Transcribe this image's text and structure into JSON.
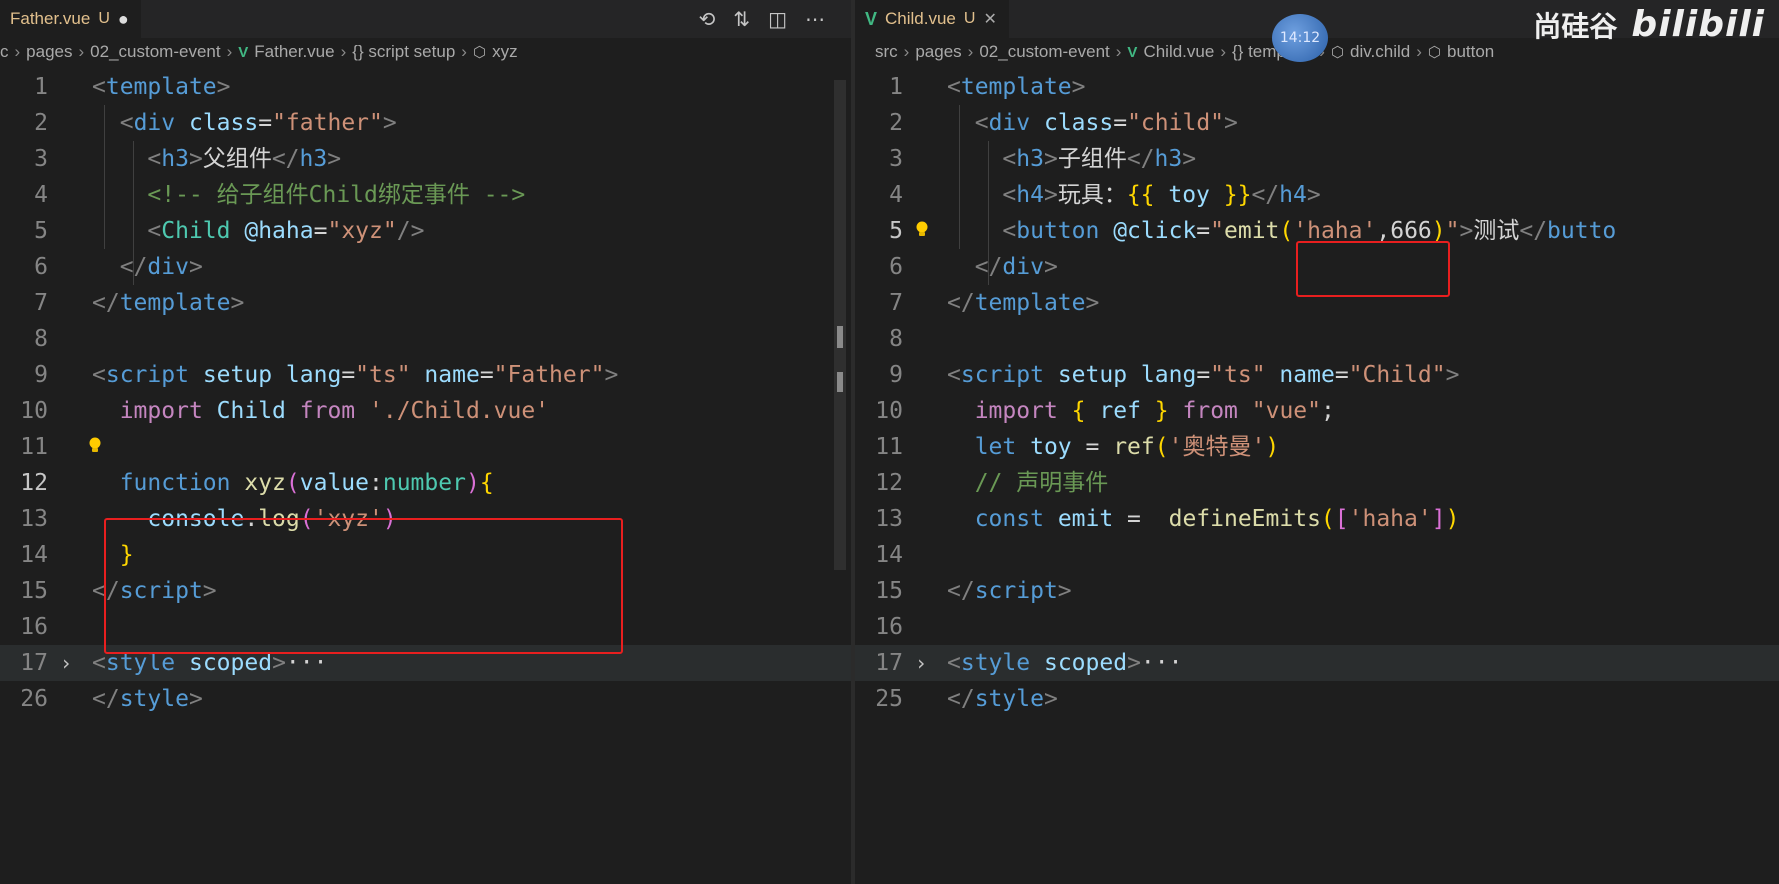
{
  "left": {
    "tab": {
      "filename": "Father.vue",
      "status": "U",
      "dirty": "●"
    },
    "breadcrumb": [
      "c",
      "pages",
      "02_custom-event",
      "Father.vue",
      "{} script setup",
      "xyz"
    ],
    "lines": [
      {
        "n": "1",
        "tokens": [
          [
            "<",
            "brk"
          ],
          [
            "template",
            "tag"
          ],
          [
            ">",
            "brk"
          ]
        ]
      },
      {
        "n": "2",
        "tokens": [
          [
            "  ",
            ""
          ],
          [
            "<",
            "brk"
          ],
          [
            "div",
            "tag"
          ],
          [
            " ",
            ""
          ],
          [
            "class",
            "attr"
          ],
          [
            "=",
            "txt"
          ],
          [
            "\"father\"",
            "str"
          ],
          [
            ">",
            "brk"
          ]
        ]
      },
      {
        "n": "3",
        "tokens": [
          [
            "    ",
            ""
          ],
          [
            "<",
            "brk"
          ],
          [
            "h3",
            "tag"
          ],
          [
            ">",
            "brk"
          ],
          [
            "父组件",
            "chn"
          ],
          [
            "</",
            "brk"
          ],
          [
            "h3",
            "tag"
          ],
          [
            ">",
            "brk"
          ]
        ]
      },
      {
        "n": "4",
        "tokens": [
          [
            "    ",
            ""
          ],
          [
            "<!-- 给子组件Child绑定事件 -->",
            "cmt"
          ]
        ]
      },
      {
        "n": "5",
        "tokens": [
          [
            "    ",
            ""
          ],
          [
            "<",
            "brk"
          ],
          [
            "Child",
            "type"
          ],
          [
            " ",
            ""
          ],
          [
            "@haha",
            "attr"
          ],
          [
            "=",
            "txt"
          ],
          [
            "\"xyz\"",
            "str"
          ],
          [
            "/>",
            "brk"
          ]
        ]
      },
      {
        "n": "6",
        "tokens": [
          [
            "  ",
            ""
          ],
          [
            "</",
            "brk"
          ],
          [
            "div",
            "tag"
          ],
          [
            ">",
            "brk"
          ]
        ]
      },
      {
        "n": "7",
        "tokens": [
          [
            "</",
            "brk"
          ],
          [
            "template",
            "tag"
          ],
          [
            ">",
            "brk"
          ]
        ]
      },
      {
        "n": "8",
        "tokens": []
      },
      {
        "n": "9",
        "tokens": [
          [
            "<",
            "brk"
          ],
          [
            "script",
            "tag"
          ],
          [
            " ",
            ""
          ],
          [
            "setup",
            "attr"
          ],
          [
            " ",
            ""
          ],
          [
            "lang",
            "attr"
          ],
          [
            "=",
            "txt"
          ],
          [
            "\"ts\"",
            "str"
          ],
          [
            " ",
            ""
          ],
          [
            "name",
            "attr"
          ],
          [
            "=",
            "txt"
          ],
          [
            "\"Father\"",
            "str"
          ],
          [
            ">",
            "brk"
          ]
        ]
      },
      {
        "n": "10",
        "tokens": [
          [
            "  ",
            ""
          ],
          [
            "import",
            "kw2"
          ],
          [
            " ",
            ""
          ],
          [
            "Child",
            "attr"
          ],
          [
            " ",
            ""
          ],
          [
            "from",
            "kw2"
          ],
          [
            " ",
            ""
          ],
          [
            "'./Child.vue'",
            "str"
          ]
        ]
      },
      {
        "n": "11",
        "tokens": []
      },
      {
        "n": "12",
        "tokens": [
          [
            "  ",
            ""
          ],
          [
            "function",
            "kw"
          ],
          [
            " ",
            ""
          ],
          [
            "xyz",
            "fn"
          ],
          [
            "(",
            "br2"
          ],
          [
            "value",
            "attr"
          ],
          [
            ":",
            "txt"
          ],
          [
            "number",
            "type"
          ],
          [
            ")",
            "br2"
          ],
          [
            "{",
            "br1"
          ]
        ]
      },
      {
        "n": "13",
        "tokens": [
          [
            "    ",
            ""
          ],
          [
            "console",
            "attr"
          ],
          [
            ".",
            "txt"
          ],
          [
            "log",
            "fn"
          ],
          [
            "(",
            "br2"
          ],
          [
            "'xyz'",
            "str"
          ],
          [
            ")",
            "br2"
          ]
        ]
      },
      {
        "n": "14",
        "tokens": [
          [
            "  ",
            ""
          ],
          [
            "}",
            "br1"
          ]
        ]
      },
      {
        "n": "15",
        "tokens": [
          [
            "</",
            "brk"
          ],
          [
            "script",
            "tag"
          ],
          [
            ">",
            "brk"
          ]
        ]
      },
      {
        "n": "16",
        "tokens": []
      },
      {
        "n": "17",
        "tokens": [
          [
            "<",
            "brk"
          ],
          [
            "style",
            "tag"
          ],
          [
            " ",
            ""
          ],
          [
            "scoped",
            "attr"
          ],
          [
            ">",
            "brk"
          ],
          [
            "···",
            "txt"
          ]
        ]
      },
      {
        "n": "26",
        "tokens": [
          [
            "</",
            "brk"
          ],
          [
            "style",
            "tag"
          ],
          [
            ">",
            "brk"
          ]
        ]
      }
    ]
  },
  "right": {
    "tab": {
      "filename": "Child.vue",
      "status": "U",
      "close": "✕"
    },
    "breadcrumb": [
      "src",
      "pages",
      "02_custom-event",
      "Child.vue",
      "{} template",
      "div.child",
      "button"
    ],
    "lines": [
      {
        "n": "1",
        "tokens": [
          [
            "<",
            "brk"
          ],
          [
            "template",
            "tag"
          ],
          [
            ">",
            "brk"
          ]
        ]
      },
      {
        "n": "2",
        "tokens": [
          [
            "  ",
            ""
          ],
          [
            "<",
            "brk"
          ],
          [
            "div",
            "tag"
          ],
          [
            " ",
            ""
          ],
          [
            "class",
            "attr"
          ],
          [
            "=",
            "txt"
          ],
          [
            "\"child\"",
            "str"
          ],
          [
            ">",
            "brk"
          ]
        ]
      },
      {
        "n": "3",
        "tokens": [
          [
            "    ",
            ""
          ],
          [
            "<",
            "brk"
          ],
          [
            "h3",
            "tag"
          ],
          [
            ">",
            "brk"
          ],
          [
            "子组件",
            "chn"
          ],
          [
            "</",
            "brk"
          ],
          [
            "h3",
            "tag"
          ],
          [
            ">",
            "brk"
          ]
        ]
      },
      {
        "n": "4",
        "tokens": [
          [
            "    ",
            ""
          ],
          [
            "<",
            "brk"
          ],
          [
            "h4",
            "tag"
          ],
          [
            ">",
            "brk"
          ],
          [
            "玩具：",
            "chn"
          ],
          [
            "{{ ",
            "br1"
          ],
          [
            "toy",
            "attr"
          ],
          [
            " }}",
            "br1"
          ],
          [
            "</",
            "brk"
          ],
          [
            "h4",
            "tag"
          ],
          [
            ">",
            "brk"
          ]
        ]
      },
      {
        "n": "5",
        "tokens": [
          [
            "    ",
            ""
          ],
          [
            "<",
            "brk"
          ],
          [
            "button",
            "tag"
          ],
          [
            " ",
            ""
          ],
          [
            "@click",
            "attr"
          ],
          [
            "=",
            "txt"
          ],
          [
            "\"",
            "str"
          ],
          [
            "emit",
            "fn"
          ],
          [
            "(",
            "br1"
          ],
          [
            "'haha'",
            "str"
          ],
          [
            ",",
            "txt"
          ],
          [
            "666",
            "txt"
          ],
          [
            ")",
            "br1"
          ],
          [
            "\"",
            "str"
          ],
          [
            ">",
            "brk"
          ],
          [
            "测试",
            "chn"
          ],
          [
            "</",
            "brk"
          ],
          [
            "butto",
            "tag"
          ]
        ]
      },
      {
        "n": "6",
        "tokens": [
          [
            "  ",
            ""
          ],
          [
            "</",
            "brk"
          ],
          [
            "div",
            "tag"
          ],
          [
            ">",
            "brk"
          ]
        ]
      },
      {
        "n": "7",
        "tokens": [
          [
            "</",
            "brk"
          ],
          [
            "template",
            "tag"
          ],
          [
            ">",
            "brk"
          ]
        ]
      },
      {
        "n": "8",
        "tokens": []
      },
      {
        "n": "9",
        "tokens": [
          [
            "<",
            "brk"
          ],
          [
            "script",
            "tag"
          ],
          [
            " ",
            ""
          ],
          [
            "setup",
            "attr"
          ],
          [
            " ",
            ""
          ],
          [
            "lang",
            "attr"
          ],
          [
            "=",
            "txt"
          ],
          [
            "\"ts\"",
            "str"
          ],
          [
            " ",
            ""
          ],
          [
            "name",
            "attr"
          ],
          [
            "=",
            "txt"
          ],
          [
            "\"Child\"",
            "str"
          ],
          [
            ">",
            "brk"
          ]
        ]
      },
      {
        "n": "10",
        "tokens": [
          [
            "  ",
            ""
          ],
          [
            "import",
            "kw2"
          ],
          [
            " ",
            ""
          ],
          [
            "{",
            "br1"
          ],
          [
            " ",
            ""
          ],
          [
            "ref",
            "attr"
          ],
          [
            " ",
            ""
          ],
          [
            "}",
            "br1"
          ],
          [
            " ",
            ""
          ],
          [
            "from",
            "kw2"
          ],
          [
            " ",
            ""
          ],
          [
            "\"vue\"",
            "str"
          ],
          [
            ";",
            "txt"
          ]
        ]
      },
      {
        "n": "11",
        "tokens": [
          [
            "  ",
            ""
          ],
          [
            "let",
            "kw"
          ],
          [
            " ",
            ""
          ],
          [
            "toy",
            "attr"
          ],
          [
            " = ",
            ""
          ],
          [
            "ref",
            "fn"
          ],
          [
            "(",
            "br1"
          ],
          [
            "'奥特曼'",
            "str"
          ],
          [
            ")",
            "br1"
          ]
        ]
      },
      {
        "n": "12",
        "tokens": [
          [
            "  ",
            ""
          ],
          [
            "// 声明事件",
            "cmt"
          ]
        ]
      },
      {
        "n": "13",
        "tokens": [
          [
            "  ",
            ""
          ],
          [
            "const",
            "kw"
          ],
          [
            " ",
            ""
          ],
          [
            "emit",
            "attr"
          ],
          [
            " =  ",
            ""
          ],
          [
            "defineEmits",
            "fn"
          ],
          [
            "(",
            "br1"
          ],
          [
            "[",
            "br2"
          ],
          [
            "'haha'",
            "str"
          ],
          [
            "]",
            "br2"
          ],
          [
            ")",
            "br1"
          ]
        ]
      },
      {
        "n": "14",
        "tokens": []
      },
      {
        "n": "15",
        "tokens": [
          [
            "</",
            "brk"
          ],
          [
            "script",
            "tag"
          ],
          [
            ">",
            "brk"
          ]
        ]
      },
      {
        "n": "16",
        "tokens": []
      },
      {
        "n": "17",
        "tokens": [
          [
            "<",
            "brk"
          ],
          [
            "style",
            "tag"
          ],
          [
            " ",
            ""
          ],
          [
            "scoped",
            "attr"
          ],
          [
            ">",
            "brk"
          ],
          [
            "···",
            "txt"
          ]
        ]
      },
      {
        "n": "25",
        "tokens": [
          [
            "</",
            "brk"
          ],
          [
            "style",
            "tag"
          ],
          [
            ">",
            "brk"
          ]
        ]
      }
    ]
  },
  "watermark": {
    "brand": "尚硅谷",
    "site": "bilibili"
  },
  "time_badge": "14:12"
}
